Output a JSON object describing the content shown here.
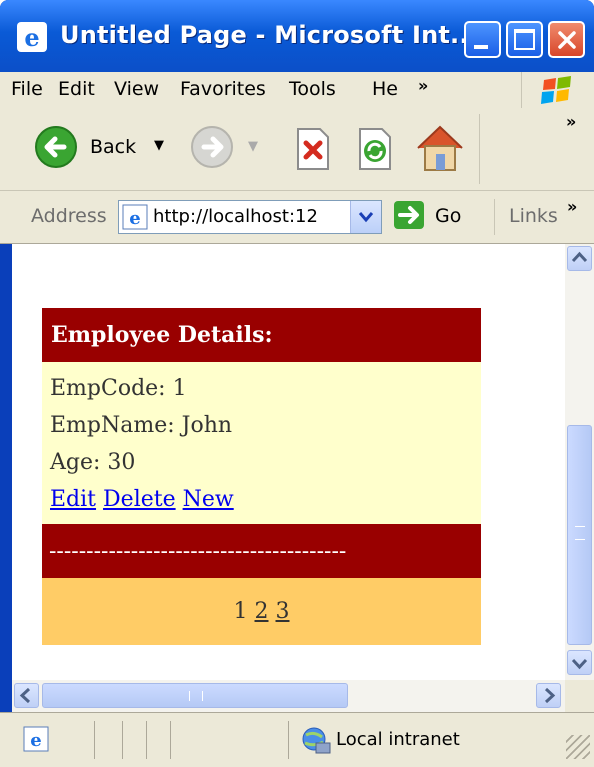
{
  "window": {
    "title": "Untitled Page - Microsoft Int..."
  },
  "menu": {
    "items": [
      "File",
      "Edit",
      "View",
      "Favorites",
      "Tools",
      "He"
    ],
    "more": "»"
  },
  "toolbar": {
    "back_label": "Back",
    "more": "»"
  },
  "address": {
    "label": "Address",
    "url": "http://localhost:12",
    "go_label": "Go",
    "links_label": "Links",
    "more": "»"
  },
  "employee": {
    "header": "Employee Details:",
    "emp_code": "EmpCode: 1",
    "emp_name": "EmpName: John",
    "age": "Age: 30",
    "actions": [
      "Edit",
      "Delete",
      "New"
    ],
    "separator": "----------------------------------------",
    "pager": {
      "current": "1",
      "pages": [
        "2",
        "3"
      ]
    }
  },
  "status": {
    "zone": "Local intranet"
  },
  "colors": {
    "header_bg": "#990000",
    "body_bg": "#ffffcc",
    "pager_bg": "#ffcc66",
    "xp_blue": "#0b4fc8"
  }
}
